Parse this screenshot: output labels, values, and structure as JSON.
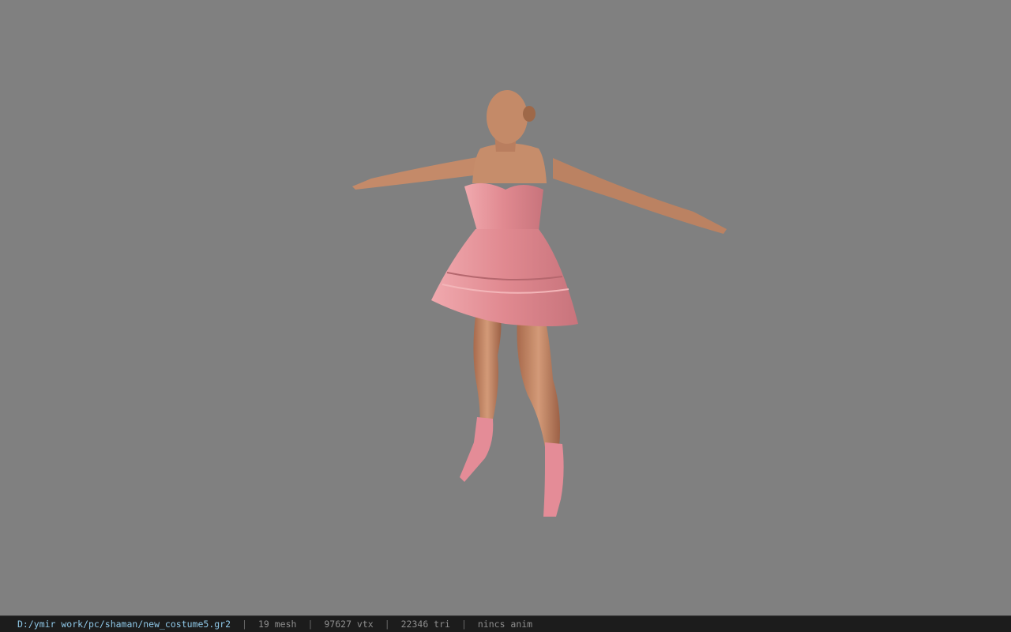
{
  "viewport": {
    "background_color": "#808080",
    "model": {
      "skin_color": "#c98e6c",
      "dress_color": "#e5939a",
      "dress_highlight": "#f2b0b4",
      "boots_color": "#e48c97"
    }
  },
  "statusbar": {
    "file_path": "D:/ymir work/pc/shaman/new_costume5.gr2",
    "sep": "|",
    "mesh": "19 mesh",
    "vtx": "97627 vtx",
    "tri": "22346 tri",
    "anim": "nincs anim"
  }
}
